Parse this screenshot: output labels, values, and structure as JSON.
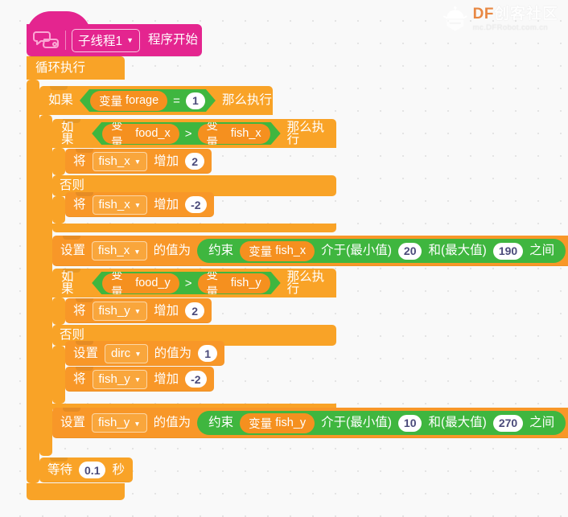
{
  "app": {
    "background_color": "#f9f9f9",
    "grid_dot_color": "#e4e4e4"
  },
  "logo": {
    "brand_prefix": "DF",
    "brand_name": "创客社区",
    "url": "mc.DFRobot.com.cn",
    "brand_color": "#E8833A",
    "icon": "dfrobot-robot-icon"
  },
  "colors": {
    "event_block": "#E4258F",
    "control_block": "#F9A327",
    "variable_block": "#F89728",
    "operator_block": "#3FB63F",
    "variable_pill": "#F5901F",
    "input_field": "#FFFFFF"
  },
  "script": {
    "hat": {
      "thread_label": "子线程1",
      "caret": "▼",
      "start_label": "程序开始",
      "icon": "thread-bubble-icon"
    },
    "forever": {
      "label": "循环执行"
    },
    "if_forage": {
      "if_label": "如果",
      "then_label": "那么执行",
      "condition": {
        "left_prefix": "变量",
        "left_name": "forage",
        "operator": "=",
        "right_value": "1"
      }
    },
    "if_food_x": {
      "if_label": "如果",
      "then_label": "那么执行",
      "else_label": "否则",
      "condition": {
        "left_prefix": "变量",
        "left_name": "food_x",
        "operator": ">",
        "right_prefix": "变量",
        "right_name": "fish_x"
      },
      "then_body": {
        "change_label": "将",
        "variable": "fish_x",
        "caret": "▼",
        "by_label": "增加",
        "value": "2"
      },
      "else_body": {
        "change_label": "将",
        "variable": "fish_x",
        "caret": "▼",
        "by_label": "增加",
        "value": "-2"
      }
    },
    "set_fish_x": {
      "set_label": "设置",
      "variable": "fish_x",
      "caret": "▼",
      "to_label": "的值为",
      "constrain_label": "约束",
      "var_prefix": "变量",
      "var_name": "fish_x",
      "between_label": "介于(最小值)",
      "min": "20",
      "and_label": "和(最大值)",
      "max": "190",
      "suffix_label": "之间"
    },
    "if_food_y": {
      "if_label": "如果",
      "then_label": "那么执行",
      "else_label": "否则",
      "condition": {
        "left_prefix": "变量",
        "left_name": "food_y",
        "operator": ">",
        "right_prefix": "变量",
        "right_name": "fish_y"
      },
      "then_body": {
        "change_label": "将",
        "variable": "fish_y",
        "caret": "▼",
        "by_label": "增加",
        "value": "2"
      },
      "else_body_set": {
        "set_label": "设置",
        "variable": "dirc",
        "caret": "▼",
        "to_label": "的值为",
        "value": "1"
      },
      "else_body_change": {
        "change_label": "将",
        "variable": "fish_y",
        "caret": "▼",
        "by_label": "增加",
        "value": "-2"
      }
    },
    "set_fish_y": {
      "set_label": "设置",
      "variable": "fish_y",
      "caret": "▼",
      "to_label": "的值为",
      "constrain_label": "约束",
      "var_prefix": "变量",
      "var_name": "fish_y",
      "between_label": "介于(最小值)",
      "min": "10",
      "and_label": "和(最大值)",
      "max": "270",
      "suffix_label": "之间"
    },
    "wait": {
      "wait_label": "等待",
      "value": "0.1",
      "unit_label": "秒"
    }
  }
}
